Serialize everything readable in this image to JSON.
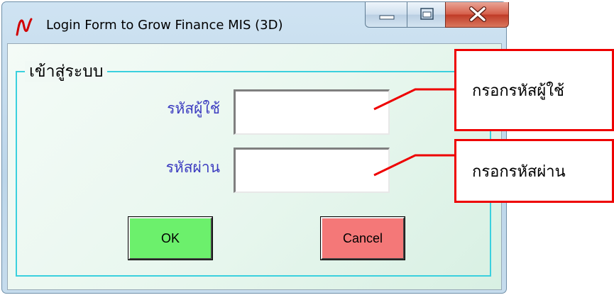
{
  "window": {
    "title": "Login Form to Grow Finance MIS (3D)",
    "app_icon": "red-n-logo-icon",
    "controls": [
      "minimize-icon",
      "maximize-icon",
      "close-icon"
    ]
  },
  "form": {
    "group_title": "เข้าสู่ระบบ",
    "username_label": "รหัสผู้ใช้",
    "username_value": "",
    "password_label": "รหัสผ่าน",
    "password_value": "",
    "ok_label": "OK",
    "cancel_label": "Cancel"
  },
  "annotations": {
    "username_note": "กรอกรหัสผู้ใช้",
    "password_note": "กรอกรหัสผ่าน"
  },
  "colors": {
    "label": "#3c3cc0",
    "ok_button": "#6cf06c",
    "cancel_button": "#f47878",
    "group_border": "#3ad0de",
    "callout_border": "#ee0000"
  }
}
